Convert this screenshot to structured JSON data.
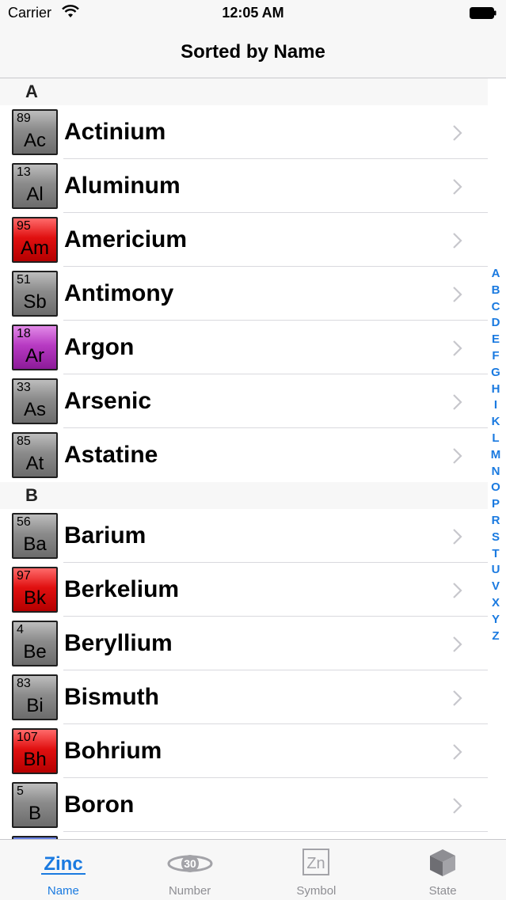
{
  "status_bar": {
    "carrier": "Carrier",
    "time": "12:05 AM"
  },
  "nav": {
    "title": "Sorted by Name"
  },
  "sections": [
    {
      "letter": "A",
      "rows": [
        {
          "num": "89",
          "symbol": "Ac",
          "name": "Actinium",
          "color": "gray"
        },
        {
          "num": "13",
          "symbol": "Al",
          "name": "Aluminum",
          "color": "gray"
        },
        {
          "num": "95",
          "symbol": "Am",
          "name": "Americium",
          "color": "red"
        },
        {
          "num": "51",
          "symbol": "Sb",
          "name": "Antimony",
          "color": "gray"
        },
        {
          "num": "18",
          "symbol": "Ar",
          "name": "Argon",
          "color": "purple"
        },
        {
          "num": "33",
          "symbol": "As",
          "name": "Arsenic",
          "color": "gray"
        },
        {
          "num": "85",
          "symbol": "At",
          "name": "Astatine",
          "color": "gray"
        }
      ]
    },
    {
      "letter": "B",
      "rows": [
        {
          "num": "56",
          "symbol": "Ba",
          "name": "Barium",
          "color": "gray"
        },
        {
          "num": "97",
          "symbol": "Bk",
          "name": "Berkelium",
          "color": "red"
        },
        {
          "num": "4",
          "symbol": "Be",
          "name": "Beryllium",
          "color": "gray"
        },
        {
          "num": "83",
          "symbol": "Bi",
          "name": "Bismuth",
          "color": "gray"
        },
        {
          "num": "107",
          "symbol": "Bh",
          "name": "Bohrium",
          "color": "red"
        },
        {
          "num": "5",
          "symbol": "B",
          "name": "Boron",
          "color": "gray"
        }
      ]
    }
  ],
  "index_letters": [
    "A",
    "B",
    "C",
    "D",
    "E",
    "F",
    "G",
    "H",
    "I",
    "K",
    "L",
    "M",
    "N",
    "O",
    "P",
    "R",
    "S",
    "T",
    "U",
    "V",
    "X",
    "Y",
    "Z"
  ],
  "tabs": [
    {
      "label": "Name",
      "icon_text": "Zinc",
      "active": true
    },
    {
      "label": "Number",
      "icon_text": "30",
      "active": false
    },
    {
      "label": "Symbol",
      "icon_text": "Zn",
      "active": false
    },
    {
      "label": "State",
      "active": false
    }
  ],
  "colors": {
    "accent": "#1a7ae0",
    "tile_gray": "#8a8a8a",
    "tile_red": "#e01010",
    "tile_purple": "#b73ac2",
    "tile_blue": "#3b56c9",
    "tab_inactive": "#8e8e93"
  }
}
